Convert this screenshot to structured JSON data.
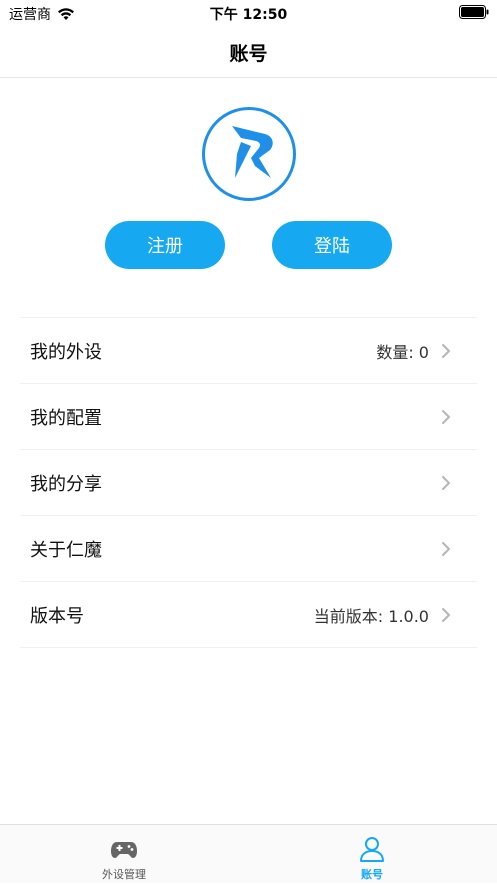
{
  "status_bar": {
    "carrier": "运营商",
    "time": "下午 12:50"
  },
  "nav": {
    "title": "账号"
  },
  "buttons": {
    "register": "注册",
    "login": "登陆"
  },
  "menu": [
    {
      "label": "我的外设",
      "value": "数量: 0"
    },
    {
      "label": "我的配置",
      "value": ""
    },
    {
      "label": "我的分享",
      "value": ""
    },
    {
      "label": "关于仁魔",
      "value": ""
    },
    {
      "label": "版本号",
      "value": "当前版本: 1.0.0"
    }
  ],
  "tabs": [
    {
      "label": "外设管理",
      "icon": "gamepad-icon",
      "active": false
    },
    {
      "label": "账号",
      "icon": "person-icon",
      "active": true
    }
  ],
  "colors": {
    "accent": "#17a8f2",
    "logo": "#1f8fe8"
  }
}
